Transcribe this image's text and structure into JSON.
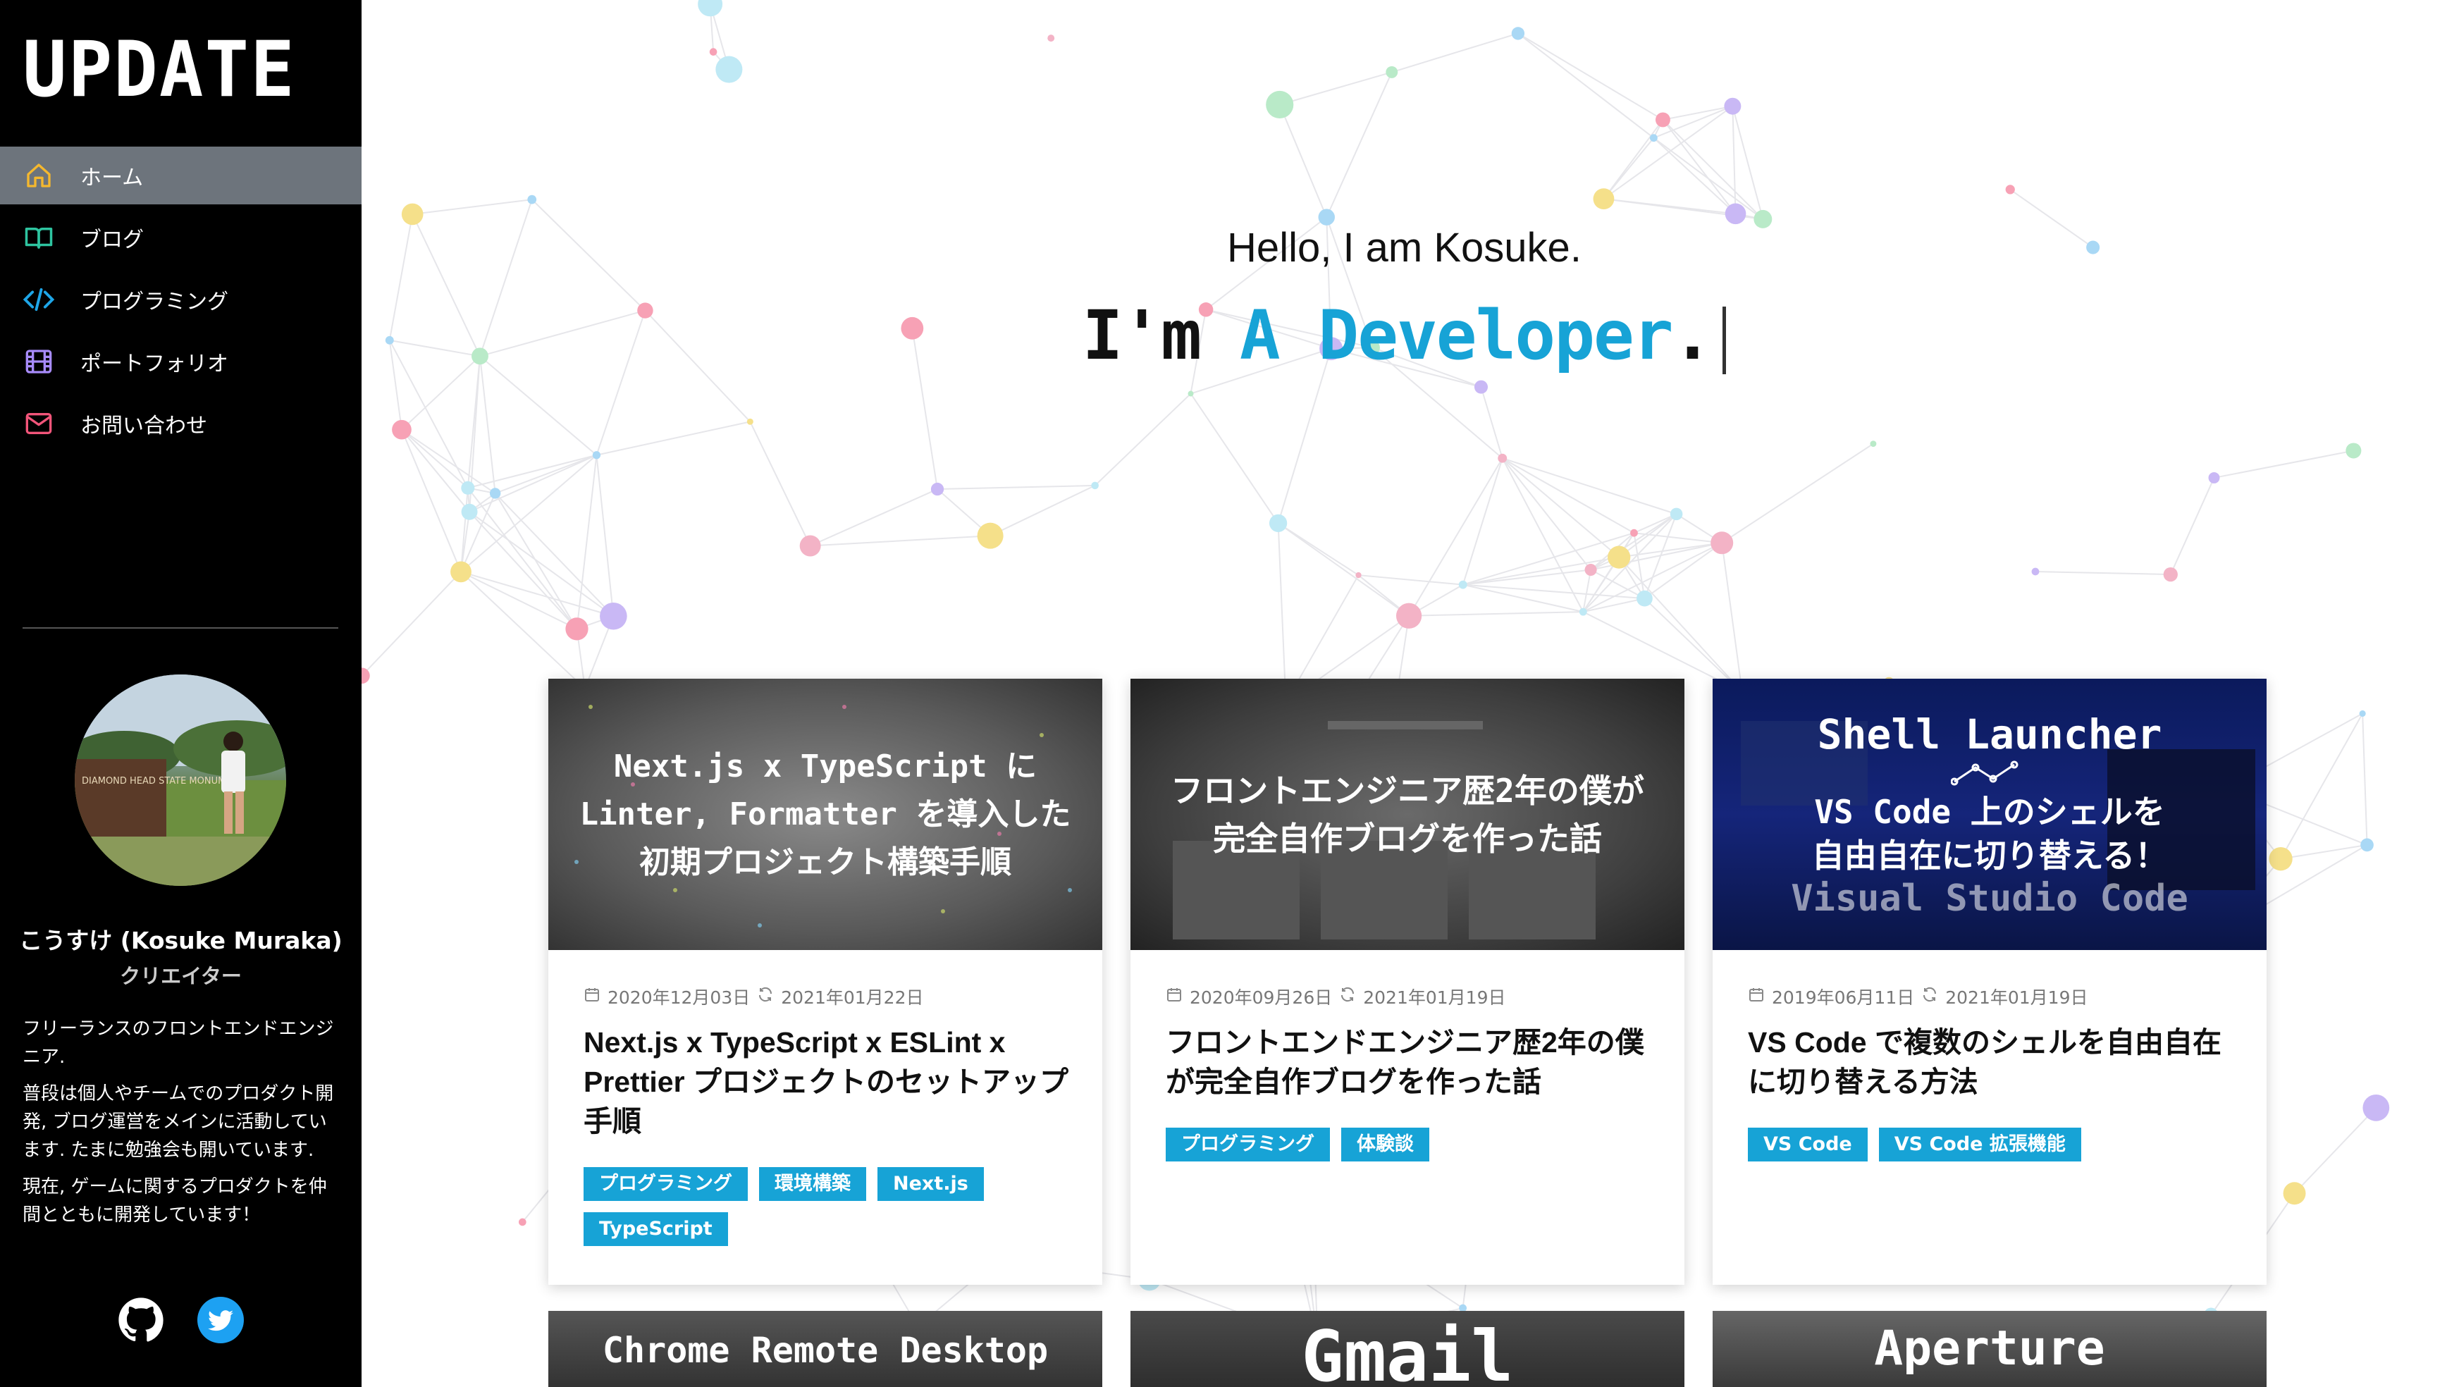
{
  "sidebar": {
    "logo": "UPDATE",
    "nav": [
      {
        "label": "ホーム",
        "icon": "home-icon",
        "color": "#f5b82e"
      },
      {
        "label": "ブログ",
        "icon": "book-icon",
        "color": "#2ec4a0"
      },
      {
        "label": "プログラミング",
        "icon": "code-icon",
        "color": "#1ea6e8"
      },
      {
        "label": "ポートフォリオ",
        "icon": "film-icon",
        "color": "#a78bfa"
      },
      {
        "label": "お問い合わせ",
        "icon": "mail-icon",
        "color": "#f2557a"
      }
    ],
    "profile": {
      "name": "こうすけ (Kosuke Muraka)",
      "role": "クリエイター",
      "avatar_sign": "DIAMOND HEAD STATE MONUMENT",
      "bio": [
        "フリーランスのフロントエンドエンジニア.",
        "普段は個人やチームでのプロダクト開発, ブログ運営をメインに活動しています. たまに勉強会も開いています.",
        "現在, ゲームに関するプロダクトを仲間とともに開発しています！"
      ]
    },
    "social": [
      {
        "icon": "github-icon"
      },
      {
        "icon": "twitter-icon"
      }
    ]
  },
  "hero": {
    "hello": "Hello, I am Kosuke.",
    "prefix": "I'm ",
    "role": "A Developer",
    "suffix": "."
  },
  "posts": [
    {
      "thumb_lines": [
        "Next.js x TypeScript に",
        "Linter, Formatter を導入した",
        "初期プロジェクト構築手順"
      ],
      "created": "2020年12月03日",
      "updated": "2021年01月22日",
      "title": "Next.js x TypeScript x ESLint x Prettier プロジェクトのセットアップ手順",
      "tags": [
        "プログラミング",
        "環境構築",
        "Next.js",
        "TypeScript"
      ]
    },
    {
      "thumb_lines": [
        "フロントエンジニア歴2年の僕が",
        "完全自作ブログを作った話"
      ],
      "created": "2020年09月26日",
      "updated": "2021年01月19日",
      "title": "フロントエンドエンジニア歴2年の僕が完全自作ブログを作った話",
      "tags": [
        "プログラミング",
        "体験談"
      ]
    },
    {
      "thumb_lines": [
        "Shell Launcher",
        "VS Code 上のシェルを",
        "自由自在に切り替える！",
        "Visual Studio Code"
      ],
      "created": "2019年06月11日",
      "updated": "2021年01月19日",
      "title": "VS Code で複数のシェルを自由自在に切り替える方法",
      "tags": [
        "VS Code",
        "VS Code 拡張機能"
      ]
    }
  ],
  "more_posts": [
    {
      "thumb_text": "Chrome Remote Desktop"
    },
    {
      "thumb_text": "Gmail"
    },
    {
      "thumb_text": "Aperture"
    }
  ],
  "colors": {
    "accent": "#17a3d6",
    "sidebar_bg": "#000000",
    "nav_active_bg": "#6d747c"
  }
}
